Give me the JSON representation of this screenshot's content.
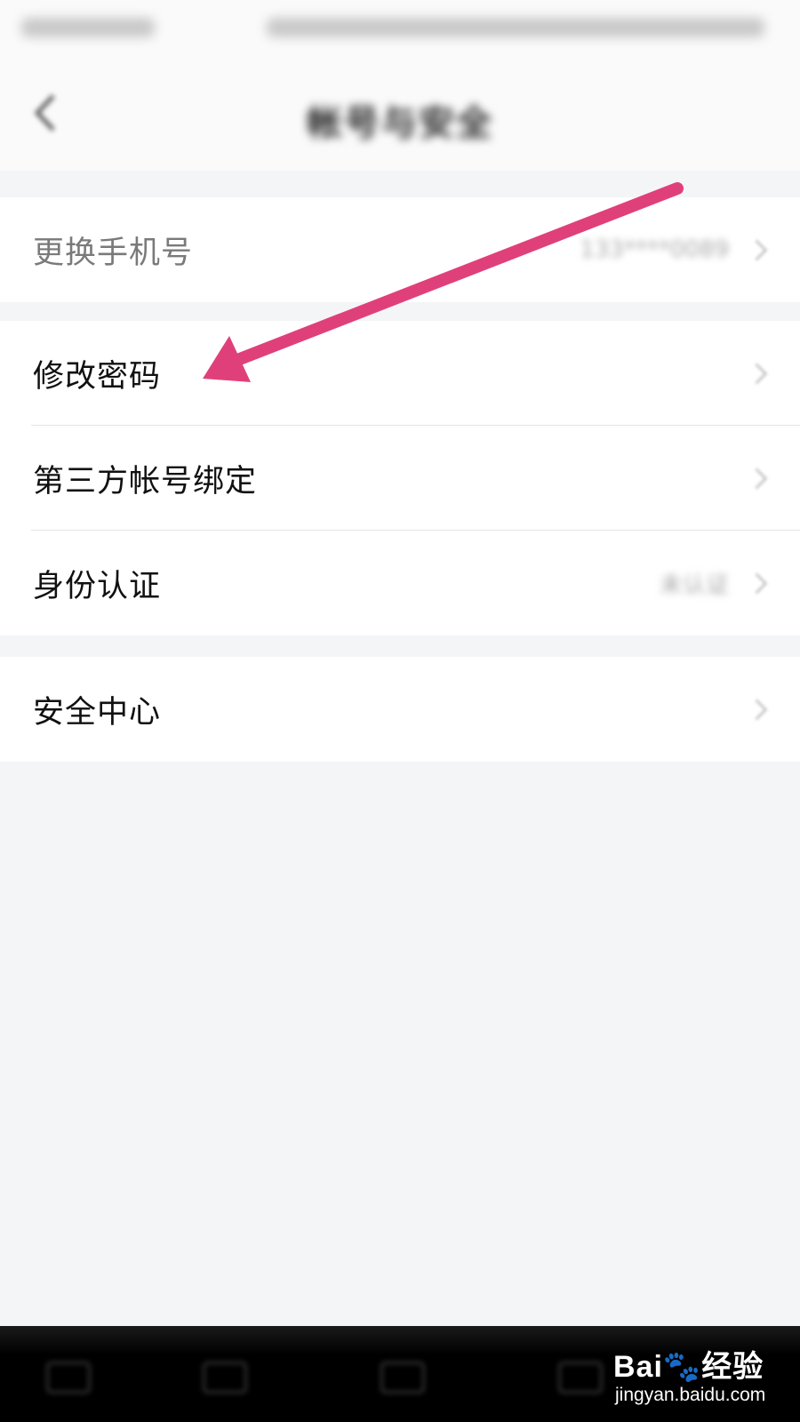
{
  "header": {
    "title": "帐号与安全",
    "back_icon": "chevron-left-icon"
  },
  "groups": [
    {
      "items": [
        {
          "label": "更换手机号",
          "value": "133****0089",
          "muted": true
        }
      ]
    },
    {
      "items": [
        {
          "label": "修改密码",
          "value": ""
        },
        {
          "label": "第三方帐号绑定",
          "value": ""
        },
        {
          "label": "身份认证",
          "value": "未认证"
        }
      ]
    },
    {
      "items": [
        {
          "label": "安全中心",
          "value": ""
        }
      ]
    }
  ],
  "annotation": {
    "arrow_color": "#e0407a",
    "target": "修改密码"
  },
  "watermark": {
    "brand_a": "Bai",
    "paw": "🐾",
    "brand_b": "经验",
    "url": "jingyan.baidu.com"
  },
  "icons": {
    "row_chevron": "chevron-right-icon"
  }
}
